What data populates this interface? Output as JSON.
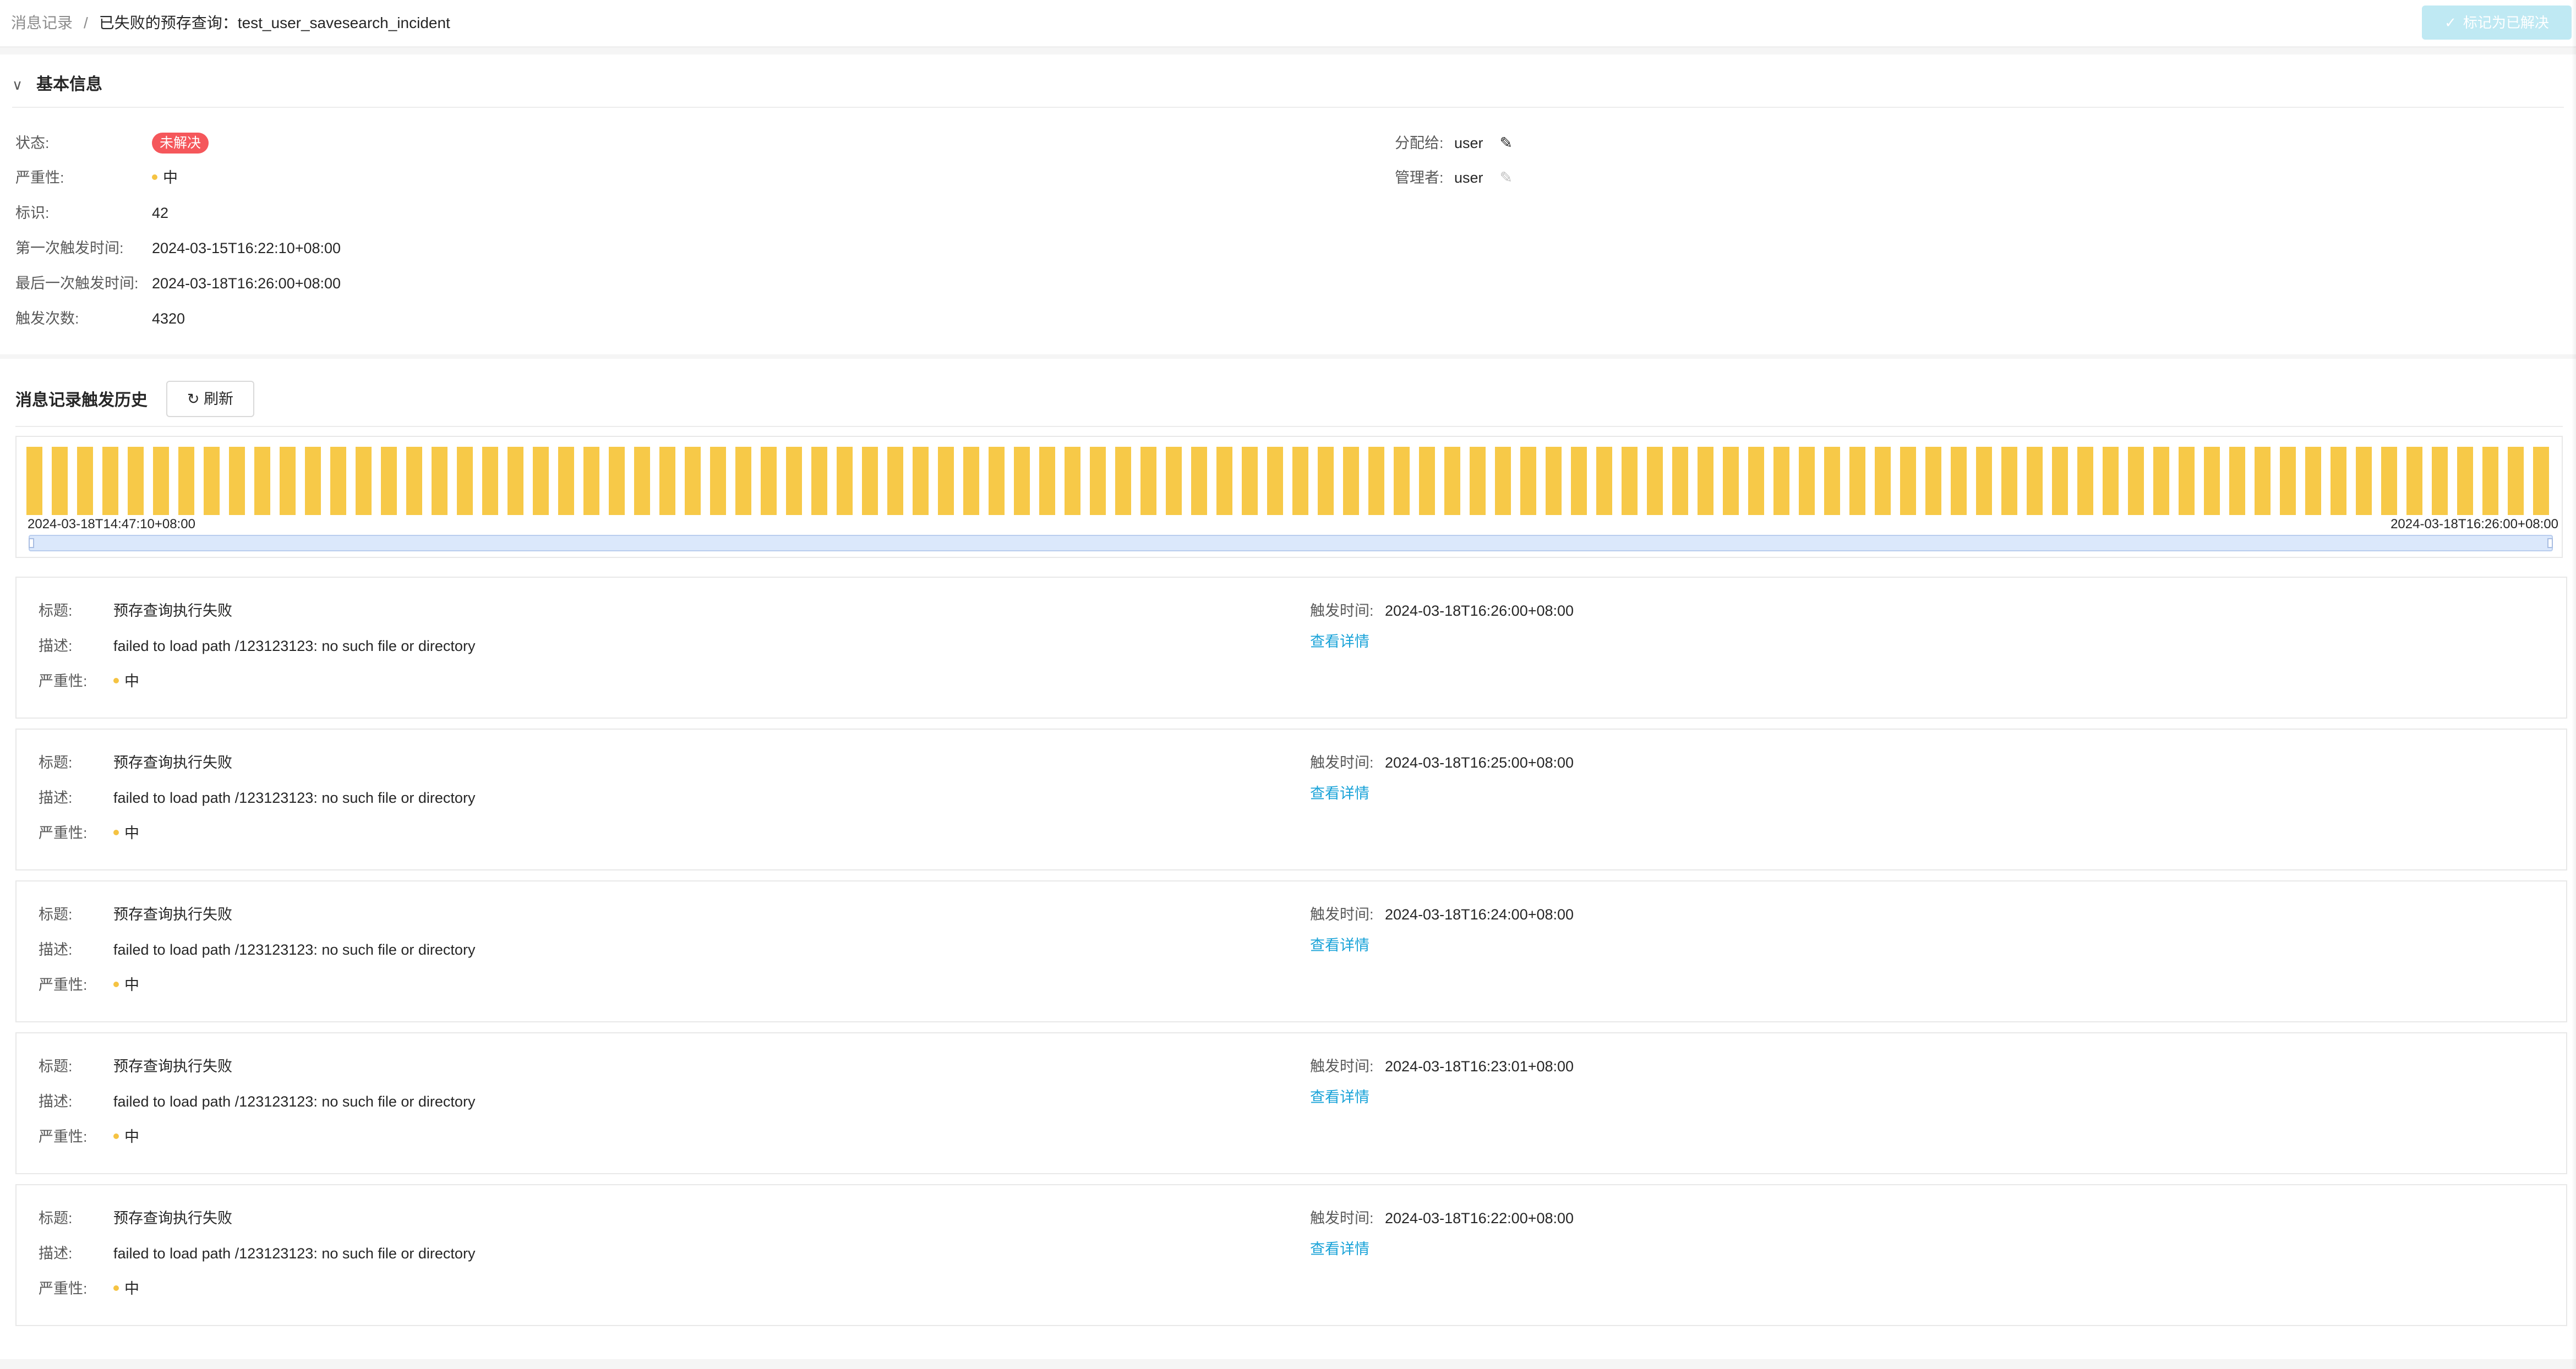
{
  "breadcrumb": {
    "parent": "消息记录",
    "separator": "/",
    "current": "已失败的预存查询：test_user_savesearch_incident"
  },
  "header": {
    "mark_resolved_label": "标记为已解决",
    "check_icon": "✓"
  },
  "basic_info": {
    "title": "基本信息",
    "status": {
      "label": "状态:",
      "value": "未解决",
      "color": "#f5575b"
    },
    "severity": {
      "label": "严重性:",
      "value": "中",
      "dot_color": "#f5c342"
    },
    "id": {
      "label": "标识:",
      "value": "42"
    },
    "first_trigger": {
      "label": "第一次触发时间:",
      "value": "2024-03-15T16:22:10+08:00"
    },
    "last_trigger": {
      "label": "最后一次触发时间:",
      "value": "2024-03-18T16:26:00+08:00"
    },
    "trigger_count": {
      "label": "触发次数:",
      "value": "4320"
    },
    "assignee": {
      "label": "分配给:",
      "value": "user"
    },
    "manager": {
      "label": "管理者:",
      "value": "user"
    }
  },
  "history": {
    "title": "消息记录触发历史",
    "refresh_label": "刷新",
    "refresh_icon": "↻"
  },
  "chart_data": {
    "type": "bar",
    "x_start_label": "2024-03-18T14:47:10+08:00",
    "x_end_label": "2024-03-18T16:26:00+08:00",
    "bar_count": 100,
    "bar_color": "#f7c948"
  },
  "records": [
    {
      "title_label": "标题:",
      "title": "预存查询执行失败",
      "desc_label": "描述:",
      "desc": "failed to load path /123123123: no such file or directory",
      "severity_label": "严重性:",
      "severity": "中",
      "time_label": "触发时间:",
      "time": "2024-03-18T16:26:00+08:00",
      "detail_link": "查看详情"
    },
    {
      "title_label": "标题:",
      "title": "预存查询执行失败",
      "desc_label": "描述:",
      "desc": "failed to load path /123123123: no such file or directory",
      "severity_label": "严重性:",
      "severity": "中",
      "time_label": "触发时间:",
      "time": "2024-03-18T16:25:00+08:00",
      "detail_link": "查看详情"
    },
    {
      "title_label": "标题:",
      "title": "预存查询执行失败",
      "desc_label": "描述:",
      "desc": "failed to load path /123123123: no such file or directory",
      "severity_label": "严重性:",
      "severity": "中",
      "time_label": "触发时间:",
      "time": "2024-03-18T16:24:00+08:00",
      "detail_link": "查看详情"
    },
    {
      "title_label": "标题:",
      "title": "预存查询执行失败",
      "desc_label": "描述:",
      "desc": "failed to load path /123123123: no such file or directory",
      "severity_label": "严重性:",
      "severity": "中",
      "time_label": "触发时间:",
      "time": "2024-03-18T16:23:01+08:00",
      "detail_link": "查看详情"
    },
    {
      "title_label": "标题:",
      "title": "预存查询执行失败",
      "desc_label": "描述:",
      "desc": "failed to load path /123123123: no such file or directory",
      "severity_label": "严重性:",
      "severity": "中",
      "time_label": "触发时间:",
      "time": "2024-03-18T16:22:00+08:00",
      "detail_link": "查看详情"
    }
  ]
}
